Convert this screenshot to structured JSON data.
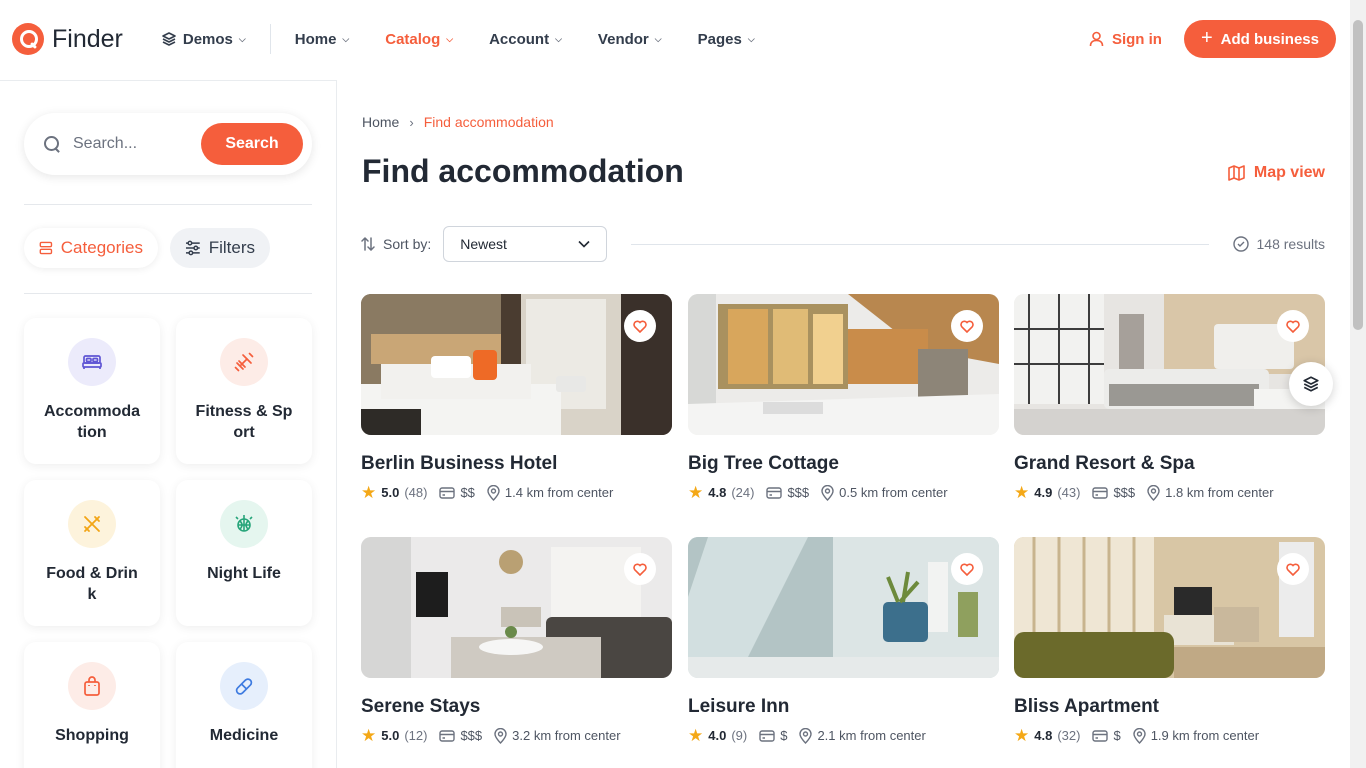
{
  "brand": {
    "name": "Finder",
    "accent": "#f55e3c"
  },
  "nav": {
    "demos": "Demos",
    "items": [
      "Home",
      "Catalog",
      "Account",
      "Vendor",
      "Pages"
    ],
    "active": "Catalog",
    "signin": "Sign in",
    "add_business": "Add business"
  },
  "sidebar": {
    "search_placeholder": "Search...",
    "search_button": "Search",
    "tabs": {
      "categories": "Categories",
      "filters": "Filters"
    },
    "categories": [
      {
        "label": "Accommodation",
        "icon": "bed-icon",
        "bg": "#ecebfb",
        "color": "#5f55d4"
      },
      {
        "label": "Fitness & Sport",
        "icon": "dumbbell-icon",
        "bg": "#fdece7",
        "color": "#f55e3c"
      },
      {
        "label": "Food & Drink",
        "icon": "utensils-icon",
        "bg": "#fdf3dc",
        "color": "#f2a516"
      },
      {
        "label": "Night Life",
        "icon": "disco-ball-icon",
        "bg": "#e5f6ef",
        "color": "#27a57a"
      },
      {
        "label": "Shopping",
        "icon": "shopping-bag-icon",
        "bg": "#fdece7",
        "color": "#f55e3c"
      },
      {
        "label": "Medicine",
        "icon": "pill-icon",
        "bg": "#e6effc",
        "color": "#3e7be0"
      }
    ]
  },
  "main": {
    "breadcrumb": [
      "Home",
      "Find accommodation"
    ],
    "title": "Find accommodation",
    "map_view": "Map view",
    "sort_label": "Sort by:",
    "sort_value": "Newest",
    "results": "148 results"
  },
  "listings": [
    {
      "title": "Berlin Business Hotel",
      "rating": "5.0",
      "reviews": "(48)",
      "price": "$$",
      "distance": "1.4 km from center"
    },
    {
      "title": "Big Tree Cottage",
      "rating": "4.8",
      "reviews": "(24)",
      "price": "$$$",
      "distance": "0.5 km from center"
    },
    {
      "title": "Grand Resort & Spa",
      "rating": "4.9",
      "reviews": "(43)",
      "price": "$$$",
      "distance": "1.8 km from center"
    },
    {
      "title": "Serene Stays",
      "rating": "5.0",
      "reviews": "(12)",
      "price": "$$$",
      "distance": "3.2 km from center"
    },
    {
      "title": "Leisure Inn",
      "rating": "4.0",
      "reviews": "(9)",
      "price": "$",
      "distance": "2.1 km from center"
    },
    {
      "title": "Bliss Apartment",
      "rating": "4.8",
      "reviews": "(32)",
      "price": "$",
      "distance": "1.9 km from center"
    }
  ]
}
